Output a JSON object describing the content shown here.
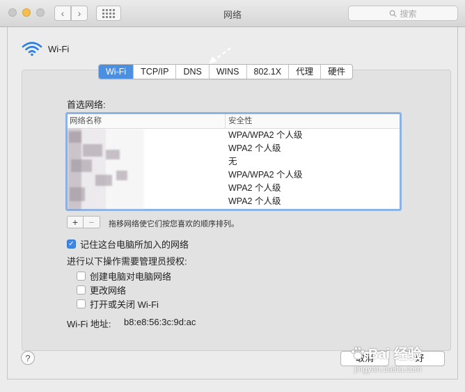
{
  "window": {
    "title": "网络",
    "search_placeholder": "搜索"
  },
  "sheet": {
    "service_name": "Wi-Fi",
    "tabs": [
      {
        "label": "Wi-Fi",
        "active": true
      },
      {
        "label": "TCP/IP",
        "active": false
      },
      {
        "label": "DNS",
        "active": false
      },
      {
        "label": "WINS",
        "active": false
      },
      {
        "label": "802.1X",
        "active": false
      },
      {
        "label": "代理",
        "active": false
      },
      {
        "label": "硬件",
        "active": false
      }
    ],
    "preferred_networks_label": "首选网络:",
    "table": {
      "columns": [
        "网络名称",
        "安全性"
      ],
      "rows": [
        {
          "name": "",
          "security": "WPA/WPA2 个人级"
        },
        {
          "name": "",
          "security": "WPA2 个人级"
        },
        {
          "name": "",
          "security": "无"
        },
        {
          "name": "",
          "security": "WPA/WPA2 个人级"
        },
        {
          "name": "",
          "security": "WPA2 个人级"
        },
        {
          "name": "",
          "security": "WPA2 个人级"
        }
      ]
    },
    "add_symbol": "+",
    "remove_symbol": "−",
    "drag_hint": "拖移网络使它们按您喜欢的顺序排列。",
    "remember_networks": {
      "label": "记住这台电脑所加入的网络",
      "checked": true
    },
    "admin_auth_label": "进行以下操作需要管理员授权:",
    "admin_options": [
      {
        "label": "创建电脑对电脑网络",
        "checked": false
      },
      {
        "label": "更改网络",
        "checked": false
      },
      {
        "label": "打开或关闭 Wi-Fi",
        "checked": false
      }
    ],
    "wifi_address_label": "Wi-Fi 地址:",
    "wifi_address": "b8:e8:56:3c:9d:ac",
    "help_symbol": "?",
    "cancel_label": "取消",
    "ok_label": "好"
  },
  "watermark": {
    "brand": "Bai 经验",
    "url": "jingyan.baidu.com"
  },
  "colors": {
    "accent": "#4a8fe0",
    "focus_ring": "#8bb2e4",
    "checkbox_on": "#3f87e5"
  }
}
